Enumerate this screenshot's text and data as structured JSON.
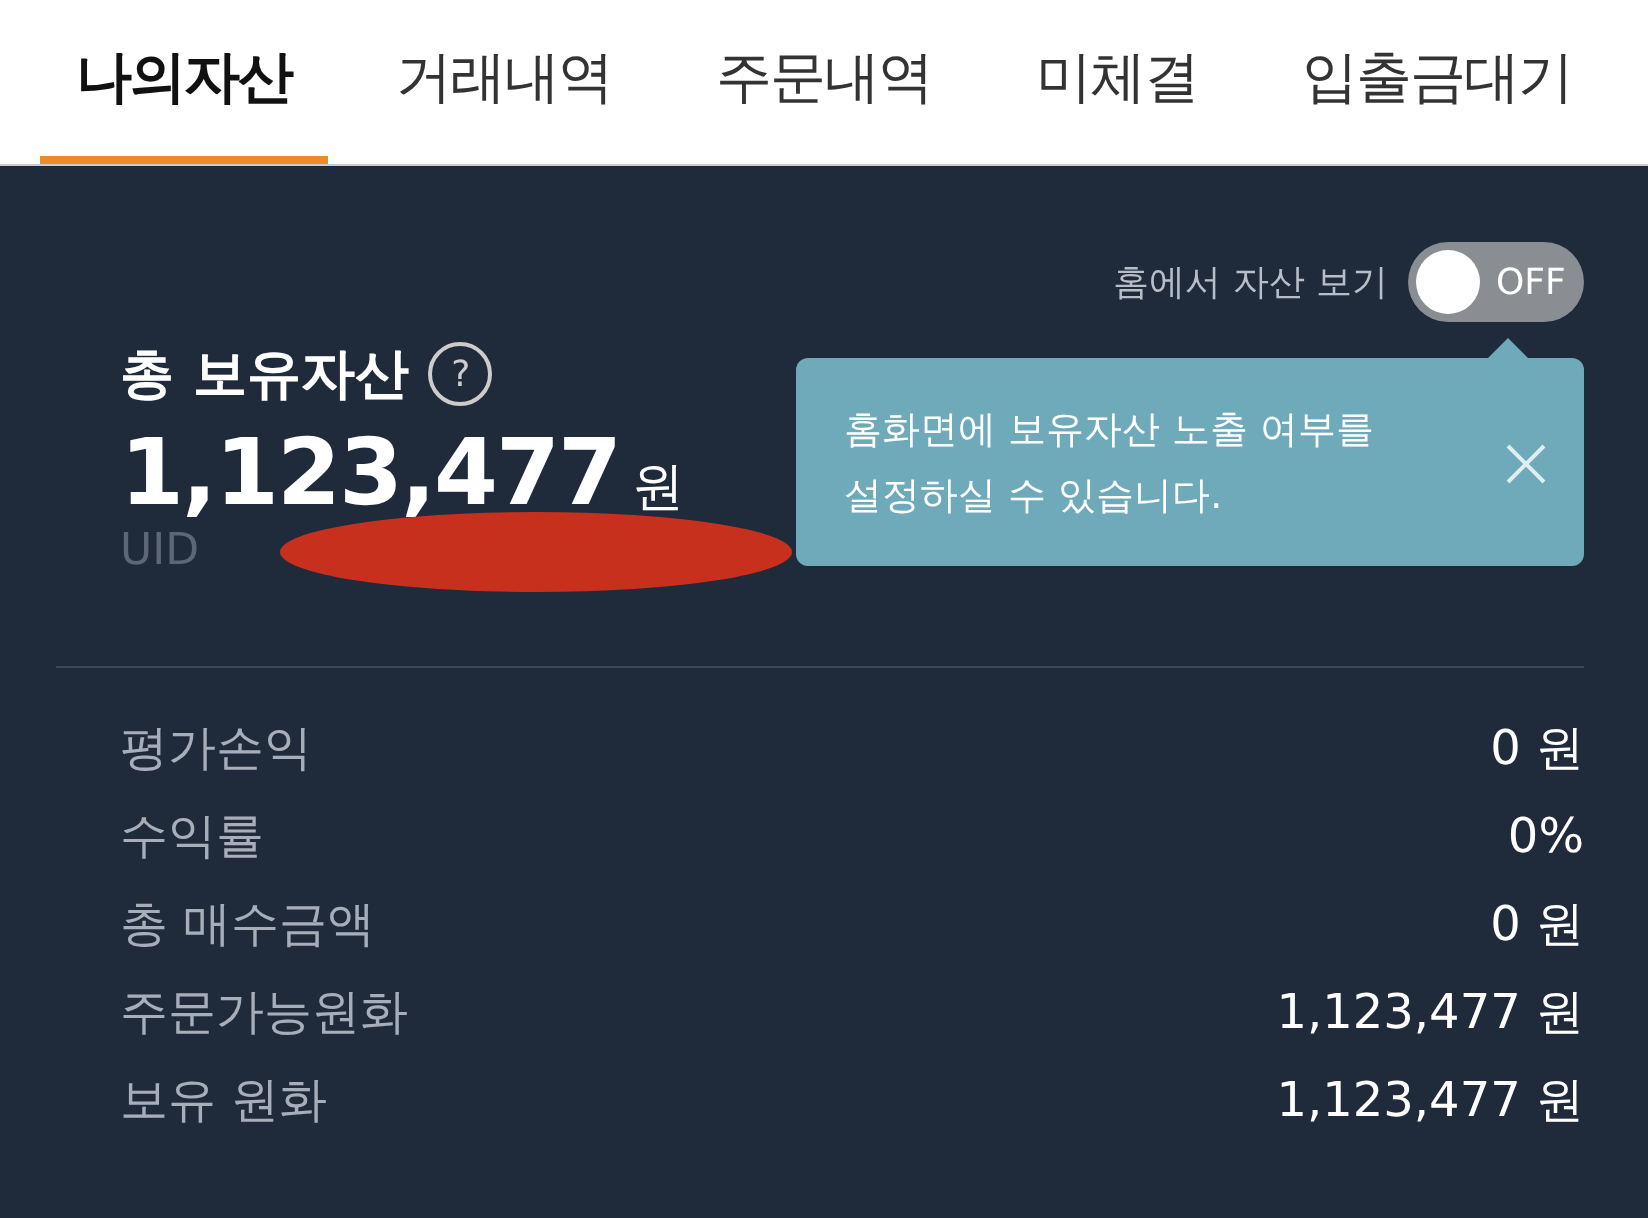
{
  "tabs": [
    {
      "label": "나의자산",
      "selected": true
    },
    {
      "label": "거래내역",
      "selected": false
    },
    {
      "label": "주문내역",
      "selected": false
    },
    {
      "label": "미체결",
      "selected": false
    },
    {
      "label": "입출금대기",
      "selected": false
    }
  ],
  "home_toggle": {
    "label": "홈에서 자산 보기",
    "on": false,
    "state_text": "OFF"
  },
  "tooltip": {
    "text": "홈화면에 보유자산 노출 여부를\n설정하실 수 있습니다."
  },
  "total": {
    "title": "총 보유자산",
    "help": "?",
    "amount": "1,123,477",
    "unit": "원",
    "uid": "UID"
  },
  "rows": [
    {
      "label": "평가손익",
      "value": "0 원"
    },
    {
      "label": "수익률",
      "value": "0%"
    },
    {
      "label": "총 매수금액",
      "value": "0 원"
    },
    {
      "label": "주문가능원화",
      "value": "1,123,477 원"
    },
    {
      "label": "보유 원화",
      "value": "1,123,477 원"
    }
  ]
}
